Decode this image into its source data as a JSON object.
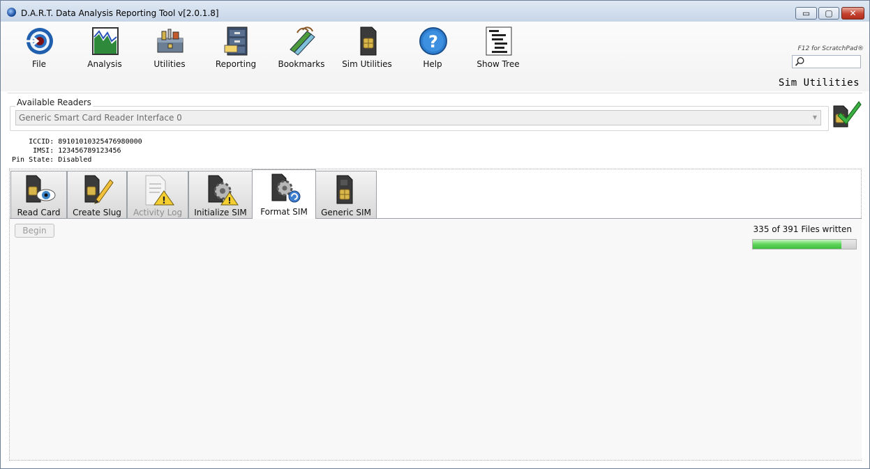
{
  "window": {
    "title": "D.A.R.T. Data Analysis Reporting Tool v[2.0.1.8]",
    "controls": {
      "minimize": "▭",
      "maximize": "▢",
      "close": "✕"
    }
  },
  "toolbar": {
    "items": [
      {
        "label": "File",
        "icon": "file-target-icon"
      },
      {
        "label": "Analysis",
        "icon": "analysis-chart-icon"
      },
      {
        "label": "Utilities",
        "icon": "toolbox-icon"
      },
      {
        "label": "Reporting",
        "icon": "filing-cabinet-icon"
      },
      {
        "label": "Bookmarks",
        "icon": "bookmarks-icon"
      },
      {
        "label": "Sim Utilities",
        "icon": "sim-card-icon"
      },
      {
        "label": "Help",
        "icon": "help-icon"
      },
      {
        "label": "Show Tree",
        "icon": "tree-icon"
      }
    ],
    "scratchpad_hint": "F12 for ScratchPad®",
    "search_placeholder": ""
  },
  "section_title": "Sim Utilities",
  "readers": {
    "legend": "Available Readers",
    "selected": "Generic Smart Card Reader Interface 0"
  },
  "sim_info": {
    "iccid_label": "ICCID:",
    "iccid": "89101010325476980000",
    "imsi_label": "IMSI:",
    "imsi": "123456789123456",
    "pin_label": "Pin State:",
    "pin_state": "Disabled"
  },
  "tabs": [
    {
      "label": "Read Card",
      "state": "normal"
    },
    {
      "label": "Create Slug",
      "state": "normal"
    },
    {
      "label": "Activity Log",
      "state": "disabled"
    },
    {
      "label": "Initialize SIM",
      "state": "normal"
    },
    {
      "label": "Format SIM",
      "state": "active"
    },
    {
      "label": "Generic SIM",
      "state": "normal"
    }
  ],
  "format_panel": {
    "begin_label": "Begin",
    "progress_text": "335 of 391 Files written",
    "files_written": 335,
    "files_total": 391
  },
  "colors": {
    "progress_green": "#3fbf3f",
    "close_red": "#c4412f",
    "titlebar": "#c7d6e8"
  }
}
